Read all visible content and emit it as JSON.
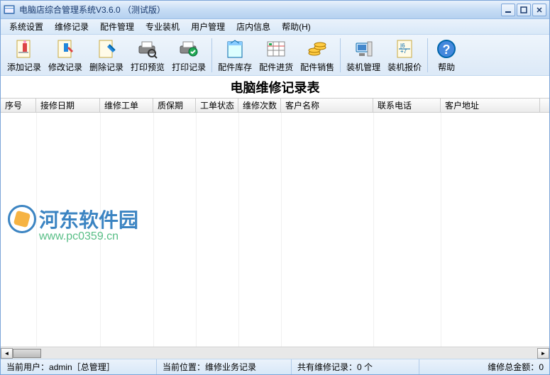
{
  "window": {
    "title": "电脑店综合管理系统V3.6.0 （测试版）"
  },
  "menu": {
    "items": [
      "系统设置",
      "维修记录",
      "配件管理",
      "专业装机",
      "用户管理",
      "店内信息",
      "帮助(H)"
    ]
  },
  "toolbar": {
    "groups": [
      [
        "添加记录",
        "修改记录",
        "删除记录",
        "打印预览",
        "打印记录"
      ],
      [
        "配件库存",
        "配件进货",
        "配件销售"
      ],
      [
        "装机管理",
        "装机报价"
      ],
      [
        "帮助"
      ]
    ],
    "icons": {
      "添加记录": "add-record-icon",
      "修改记录": "edit-record-icon",
      "删除记录": "delete-record-icon",
      "打印预览": "print-preview-icon",
      "打印记录": "print-record-icon",
      "配件库存": "inventory-icon",
      "配件进货": "purchase-icon",
      "配件销售": "sales-icon",
      "装机管理": "assembly-mgmt-icon",
      "装机报价": "assembly-quote-icon",
      "帮助": "help-icon"
    }
  },
  "content": {
    "title": "电脑维修记录表",
    "columns": [
      "序号",
      "接修日期",
      "维修工单",
      "质保期",
      "工单状态",
      "维修次数",
      "客户名称",
      "联系电话",
      "客户地址"
    ],
    "rows": []
  },
  "watermark": {
    "text": "河东软件园",
    "url": "www.pc0359.cn"
  },
  "status": {
    "user_label": "当前用户：",
    "user_value": "admin［总管理］",
    "location_label": "当前位置：",
    "location_value": "维修业务记录",
    "count_label": "共有维修记录：",
    "count_value": "0 个",
    "total_label": "维修总金额：",
    "total_value": "0"
  }
}
